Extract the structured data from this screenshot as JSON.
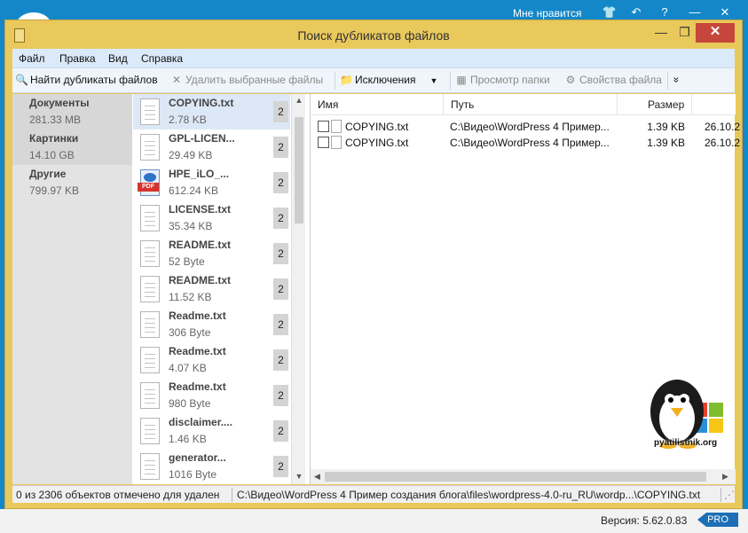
{
  "outer_bar": {
    "like_label": "Мне нравится",
    "icons": [
      "shirt-icon",
      "undo-icon",
      "help-icon",
      "minimize-icon",
      "close-icon"
    ]
  },
  "window": {
    "title": "Поиск дубликатов файлов",
    "minimize": "—",
    "maximize": "❐",
    "close": "✕"
  },
  "menu": [
    "Файл",
    "Правка",
    "Вид",
    "Справка"
  ],
  "toolbar": {
    "find": "Найти дубликаты файлов",
    "delete": "Удалить выбранные файлы",
    "exclusions": "Исключения",
    "view_folder": "Просмотр папки",
    "file_props": "Свойства файла",
    "overflow": "»"
  },
  "categories": [
    {
      "name": "Документы",
      "size": "281.33 MB"
    },
    {
      "name": "Картинки",
      "size": "14.10 GB"
    },
    {
      "name": "Другие",
      "size": "799.97 KB"
    }
  ],
  "files": [
    {
      "name": "COPYING.txt",
      "size": "2.78 KB",
      "count": "2",
      "icon": "text-file-icon"
    },
    {
      "name": "GPL-LICEN...",
      "size": "29.49 KB",
      "count": "2",
      "icon": "text-file-icon"
    },
    {
      "name": "HPE_iLO_...",
      "size": "612.24 KB",
      "count": "2",
      "icon": "pdf-file-icon"
    },
    {
      "name": "LICENSE.txt",
      "size": "35.34 KB",
      "count": "2",
      "icon": "text-file-icon"
    },
    {
      "name": "README.txt",
      "size": "52 Byte",
      "count": "2",
      "icon": "text-file-icon"
    },
    {
      "name": "README.txt",
      "size": "11.52 KB",
      "count": "2",
      "icon": "text-file-icon"
    },
    {
      "name": "Readme.txt",
      "size": "306 Byte",
      "count": "2",
      "icon": "text-file-icon"
    },
    {
      "name": "Readme.txt",
      "size": "4.07 KB",
      "count": "2",
      "icon": "text-file-icon"
    },
    {
      "name": "Readme.txt",
      "size": "980 Byte",
      "count": "2",
      "icon": "text-file-icon"
    },
    {
      "name": "disclaimer....",
      "size": "1.46 KB",
      "count": "2",
      "icon": "text-file-icon"
    },
    {
      "name": "generator...",
      "size": "1016 Byte",
      "count": "2",
      "icon": "text-file-icon"
    }
  ],
  "table": {
    "columns": [
      "Имя",
      "Путь",
      "Размер"
    ],
    "rows": [
      {
        "name": "COPYING.txt",
        "path": "C:\\Видео\\WordPress 4 Пример...",
        "size": "1.39 KB",
        "date": "26.10.2"
      },
      {
        "name": "COPYING.txt",
        "path": "C:\\Видео\\WordPress 4 Пример...",
        "size": "1.39 KB",
        "date": "26.10.2"
      }
    ]
  },
  "logo_text": "pyatilistnik.org",
  "status": {
    "selected": "0 из 2306 объектов отмечено для удален",
    "path": "C:\\Видео\\WordPress 4 Пример создания блога\\files\\wordpress-4.0-ru_RU\\wordp...\\COPYING.txt"
  },
  "footer": {
    "version": "Версия: 5.62.0.83",
    "edition": "PRO"
  },
  "colors": {
    "window_frame": "#e9c85c",
    "outer_background": "#1487c9",
    "close_button": "#c7463b",
    "pro_badge": "#1c6fb6"
  }
}
